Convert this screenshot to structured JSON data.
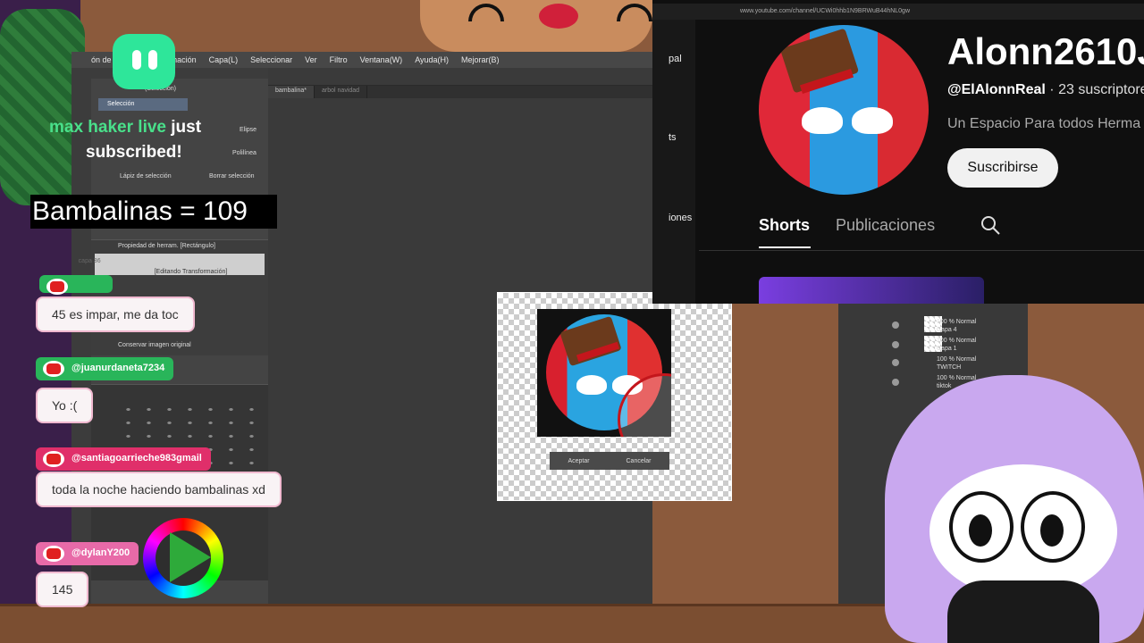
{
  "drawing_app": {
    "menu": [
      "ón de la página",
      "Animación",
      "Capa(L)",
      "Seleccionar",
      "Ver",
      "Filtro",
      "Ventana(W)",
      "Ayuda(H)",
      "Mejorar(B)"
    ],
    "tabs": [
      "bambalina*",
      "arbol navidad"
    ],
    "tool_panel": {
      "header": "(Selección)",
      "selected_item": "Selección",
      "options": [
        "Elipse",
        "Polilínea",
        "Lápiz de selección",
        "Borrar selección"
      ]
    },
    "tool_property": {
      "title": "Propiedad de herram. [Rectángulo]",
      "layer_label": "capa 36",
      "editing_label": "[Editando Transformación]",
      "keep_original_label": "Conservar imagen original"
    },
    "transform_buttons": {
      "accept": "Aceptar",
      "cancel": "Cancelar"
    },
    "layers": [
      {
        "line1": "100 % Normal",
        "line2": "Capa 4"
      },
      {
        "line1": "100 % Normal",
        "line2": "Capa 1"
      },
      {
        "line1": "100 % Normal",
        "line2": "TWITCH"
      },
      {
        "line1": "100 % Normal",
        "line2": "tiktok"
      }
    ]
  },
  "browser": {
    "url": "www.youtube.com/channel/UCWi0hhb1N9BRWuB44hNL0gw",
    "side_labels": [
      "pal",
      "ts",
      "iones"
    ],
    "channel_name": "Alonn2610J",
    "handle": "@ElAlonnReal",
    "subscribers": "· 23 suscriptore",
    "description": "Un Espacio Para todos Herma",
    "subscribe_label": "Suscribirse",
    "tabs": [
      "Shorts",
      "Publicaciones"
    ],
    "active_tab": "Shorts"
  },
  "overlay": {
    "sub_alert_user": "max haker live",
    "sub_alert_text": "just",
    "sub_alert_text2": "subscribed!",
    "counter": "Bambalinas = 109",
    "chat": [
      {
        "user": "",
        "message": "45 es impar, me da toc"
      },
      {
        "user": "@juanurdaneta7234",
        "message": "Yo :("
      },
      {
        "user": "@santiagoarrieche983gmail",
        "message": "toda la noche haciendo bambalinas xd"
      },
      {
        "user": "@dylanY200",
        "message": "145"
      }
    ]
  },
  "colors": {
    "chat_name_red": "#e02f6a",
    "chat_name_green": "#29b55a",
    "chat_name_pink": "#e86aa8",
    "alert_green": "#49e08a",
    "youtube_bg": "#0f0f0f",
    "vtuber_hair": "#c9a8ef"
  }
}
